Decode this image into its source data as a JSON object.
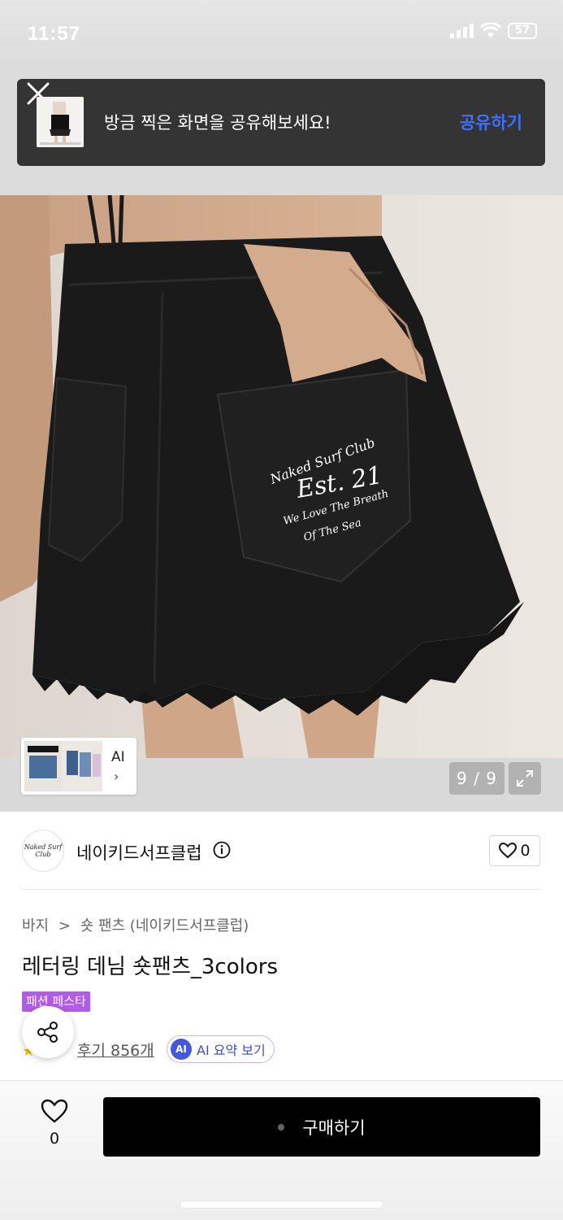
{
  "status_bar": {
    "time": "11:57",
    "battery": "57"
  },
  "toast": {
    "message": "방금 찍은 화면을 공유해보세요!",
    "action": "공유하기"
  },
  "gallery": {
    "ai_label": "AI",
    "page_counter": "9 / 9",
    "embroidery": {
      "line1": "Naked Surf Club",
      "line2": "Est. 21",
      "line3": "We Love The Breath",
      "line4": "Of The Sea"
    }
  },
  "brand": {
    "logo_text": "Naked Surf Club",
    "name": "네이키드서프클럽",
    "like_count": "0"
  },
  "product": {
    "breadcrumb": [
      "바지",
      ">",
      "숏 팬츠 (네이키드서프클럽)"
    ],
    "title": "레터링 데님 숏팬츠_3colors",
    "badge": "패션 페스타",
    "review_link": "후기 856개",
    "ai_chip": "AI",
    "ai_summary": "AI 요약 보기"
  },
  "bottom_bar": {
    "wishlist_count": "0",
    "buy_label": "구매하기"
  },
  "colors": {
    "toast_bg": "#343434",
    "toast_action": "#3d6fff",
    "badge_purple": "#b25be8",
    "ai_blue": "#4458d9",
    "buy_button": "#000000"
  }
}
